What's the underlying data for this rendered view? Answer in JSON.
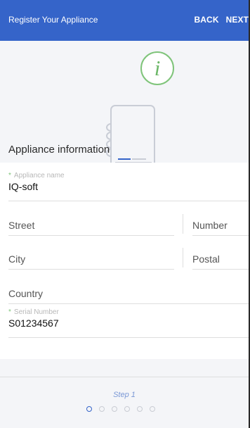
{
  "header": {
    "title": "Register Your Appliance",
    "back_label": "BACK",
    "next_label": "NEXT"
  },
  "hero": {
    "icons": [
      "book-icon",
      "info-icon"
    ],
    "info_glyph": "i"
  },
  "section": {
    "title": "Appliance information"
  },
  "form": {
    "appliance_name": {
      "label": "Appliance name",
      "value": "IQ-soft",
      "required": true
    },
    "street": {
      "placeholder": "Street"
    },
    "number": {
      "placeholder": "Number"
    },
    "city": {
      "placeholder": "City"
    },
    "postal": {
      "placeholder": "Postal"
    },
    "country": {
      "placeholder": "Country"
    },
    "serial_number": {
      "label": "Serial Number",
      "value": "S01234567",
      "required": true
    },
    "required_marker": "*"
  },
  "stepper": {
    "label": "Step 1",
    "total_steps": 6,
    "current_step": 1
  },
  "colors": {
    "accent": "#3564c9",
    "green": "#7fc47a",
    "background": "#f4f5f8"
  }
}
